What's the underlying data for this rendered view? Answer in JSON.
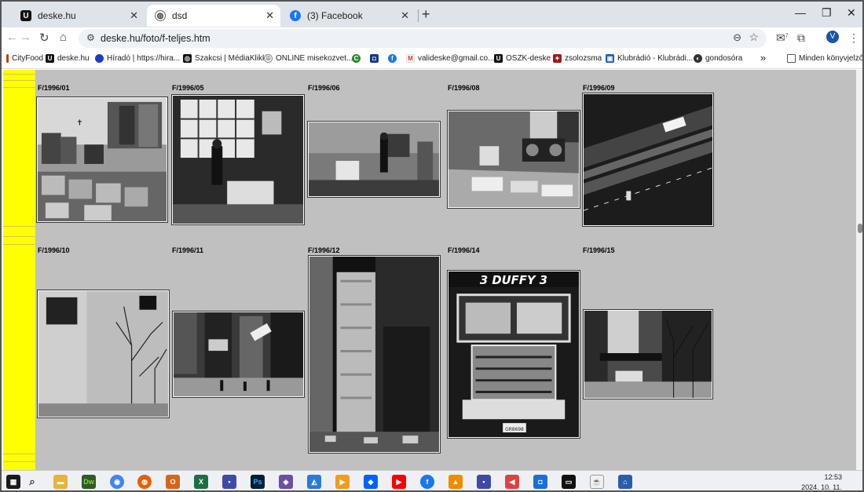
{
  "tabs": [
    {
      "title": "deske.hu",
      "favicon": "deske-favicon-icon",
      "active": false
    },
    {
      "title": "dsd",
      "favicon": "globe-icon",
      "active": true
    },
    {
      "title": "(3) Facebook",
      "favicon": "facebook-icon",
      "active": false
    }
  ],
  "address": {
    "url": "deske.hu/foto/f-teljes.htm"
  },
  "bookmarks": [
    {
      "label": "CityFood",
      "icon": "cityfood-icon"
    },
    {
      "label": "deske.hu",
      "icon": "deske-favicon-icon"
    },
    {
      "label": "Híradó | https://hira...",
      "icon": "hirado-icon"
    },
    {
      "label": "Szakcsi | MédiaKlikk",
      "icon": "mediaklikk-icon"
    },
    {
      "label": "ONLINE misekozvet...",
      "icon": "mise-icon"
    },
    {
      "label": "",
      "icon": "green-c-icon"
    },
    {
      "label": "",
      "icon": "blue-square-icon"
    },
    {
      "label": "",
      "icon": "facebook-icon"
    },
    {
      "label": "valideske@gmail.co...",
      "icon": "gmail-icon"
    },
    {
      "label": "OSZK-deske",
      "icon": "deske-favicon-icon"
    },
    {
      "label": "zsolozsma",
      "icon": "zsolozsma-icon"
    },
    {
      "label": "Klubrádió - Klubrádi...",
      "icon": "klubradio-icon"
    },
    {
      "label": "gondosóra",
      "icon": "gondosora-icon"
    }
  ],
  "bookmarks_overflow": "»",
  "bookmarks_folder": "Minden könyvjelző",
  "profile_initial": "V",
  "mail_badge": "7",
  "photos_row1": [
    "F/1996/01",
    "F/1996/05",
    "F/1996/06",
    "F/1996/08",
    "F/1996/09"
  ],
  "photos_row2": [
    "F/1996/10",
    "F/1996/11",
    "F/1996/12",
    "F/1996/14",
    "F/1996/15"
  ],
  "photo_texts": {
    "duffy": "3 DUFFY 3",
    "plate": "GR8698"
  },
  "clock": {
    "time": "12:53",
    "date": "2024. 10. 11."
  },
  "colors": {
    "sidebar": "#ffff00",
    "page_bg": "#c0c0c0"
  }
}
